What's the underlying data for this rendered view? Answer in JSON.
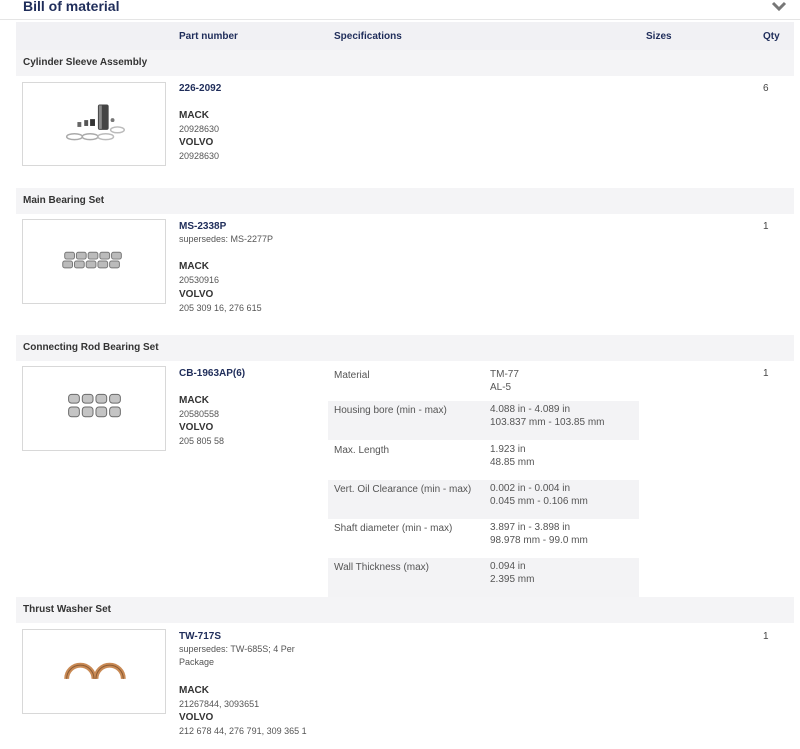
{
  "page": {
    "title": "Bill of material"
  },
  "columns": {
    "part_number": "Part number",
    "specifications": "Specifications",
    "sizes": "Sizes",
    "qty": "Qty"
  },
  "sections": [
    {
      "name": "Cylinder Sleeve Assembly",
      "part_number": "226-2092",
      "supersedes": "",
      "brands": [
        {
          "name": "MACK",
          "numbers": "20928630"
        },
        {
          "name": "VOLVO",
          "numbers": "20928630"
        }
      ],
      "qty": "6",
      "image_icon": "cylinder-sleeve-kit-photo"
    },
    {
      "name": "Main Bearing Set",
      "part_number": "MS-2338P",
      "supersedes": "supersedes: MS-2277P",
      "brands": [
        {
          "name": "MACK",
          "numbers": "20530916"
        },
        {
          "name": "VOLVO",
          "numbers": "205 309 16, 276 615"
        }
      ],
      "qty": "1",
      "image_icon": "main-bearing-set-photo"
    },
    {
      "name": "Connecting Rod Bearing Set",
      "part_number": "CB-1963AP(6)",
      "supersedes": "",
      "brands": [
        {
          "name": "MACK",
          "numbers": "20580558"
        },
        {
          "name": "VOLVO",
          "numbers": "205 805 58"
        }
      ],
      "qty": "1",
      "image_icon": "rod-bearing-set-photo",
      "specs": [
        {
          "label": "Material",
          "value1": "TM-77",
          "value2": "AL-5"
        },
        {
          "label": "Housing bore (min - max)",
          "value1": "4.088 in - 4.089 in",
          "value2": "103.837 mm - 103.85 mm"
        },
        {
          "label": "Max. Length",
          "value1": "1.923 in",
          "value2": "48.85 mm"
        },
        {
          "label": "Vert. Oil Clearance (min - max)",
          "value1": "0.002 in - 0.004 in",
          "value2": "0.045 mm - 0.106 mm"
        },
        {
          "label": "Shaft diameter (min - max)",
          "value1": "3.897 in - 3.898 in",
          "value2": "98.978 mm - 99.0 mm"
        },
        {
          "label": "Wall Thickness (max)",
          "value1": "0.094 in",
          "value2": "2.395 mm"
        }
      ]
    },
    {
      "name": "Thrust Washer Set",
      "part_number": "TW-717S",
      "supersedes": "supersedes: TW-685S; 4 Per",
      "supersedes2": "Package",
      "brands": [
        {
          "name": "MACK",
          "numbers": "21267844, 3093651"
        },
        {
          "name": "VOLVO",
          "numbers": "212 678 44, 276 791, 309 365 1"
        }
      ],
      "qty": "1",
      "image_icon": "thrust-washer-photo"
    }
  ],
  "colors": {
    "heading": "#1f2d5a",
    "header_bg": "#f1f1f4",
    "copper": "#c98a55"
  }
}
